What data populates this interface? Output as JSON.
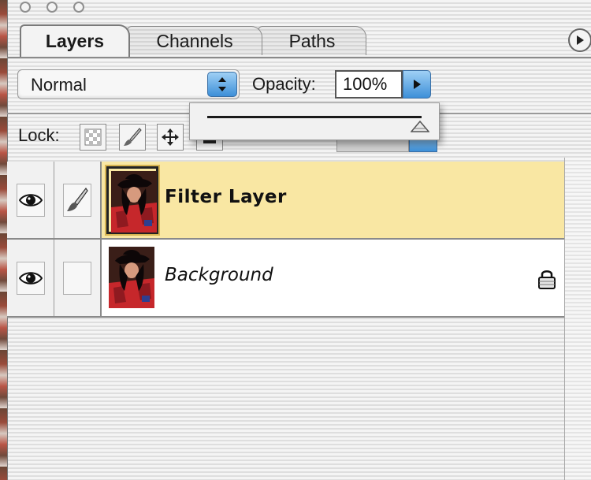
{
  "tabs": [
    {
      "label": "Layers",
      "active": true
    },
    {
      "label": "Channels",
      "active": false
    },
    {
      "label": "Paths",
      "active": false
    }
  ],
  "blend_mode": {
    "selected": "Normal"
  },
  "opacity": {
    "label": "Opacity:",
    "value": "100%",
    "slider_fraction": 1.0
  },
  "lock": {
    "label": "Lock:"
  },
  "layers": [
    {
      "name": "Filter Layer",
      "selected": true,
      "visible": true,
      "locked": false
    },
    {
      "name": "Background",
      "selected": false,
      "visible": true,
      "locked": true
    }
  ],
  "colors": {
    "selected_row": "#f9e7a3",
    "accent_blue": "#3d8fd8"
  },
  "icons": [
    "close-window-icon",
    "minimize-window-icon",
    "zoom-window-icon",
    "panel-menu-icon",
    "stepper-icon",
    "popup-arrow-icon",
    "lock-transparent-icon",
    "lock-paint-icon",
    "lock-move-icon",
    "lock-all-icon",
    "eye-icon",
    "brush-icon",
    "padlock-icon"
  ]
}
